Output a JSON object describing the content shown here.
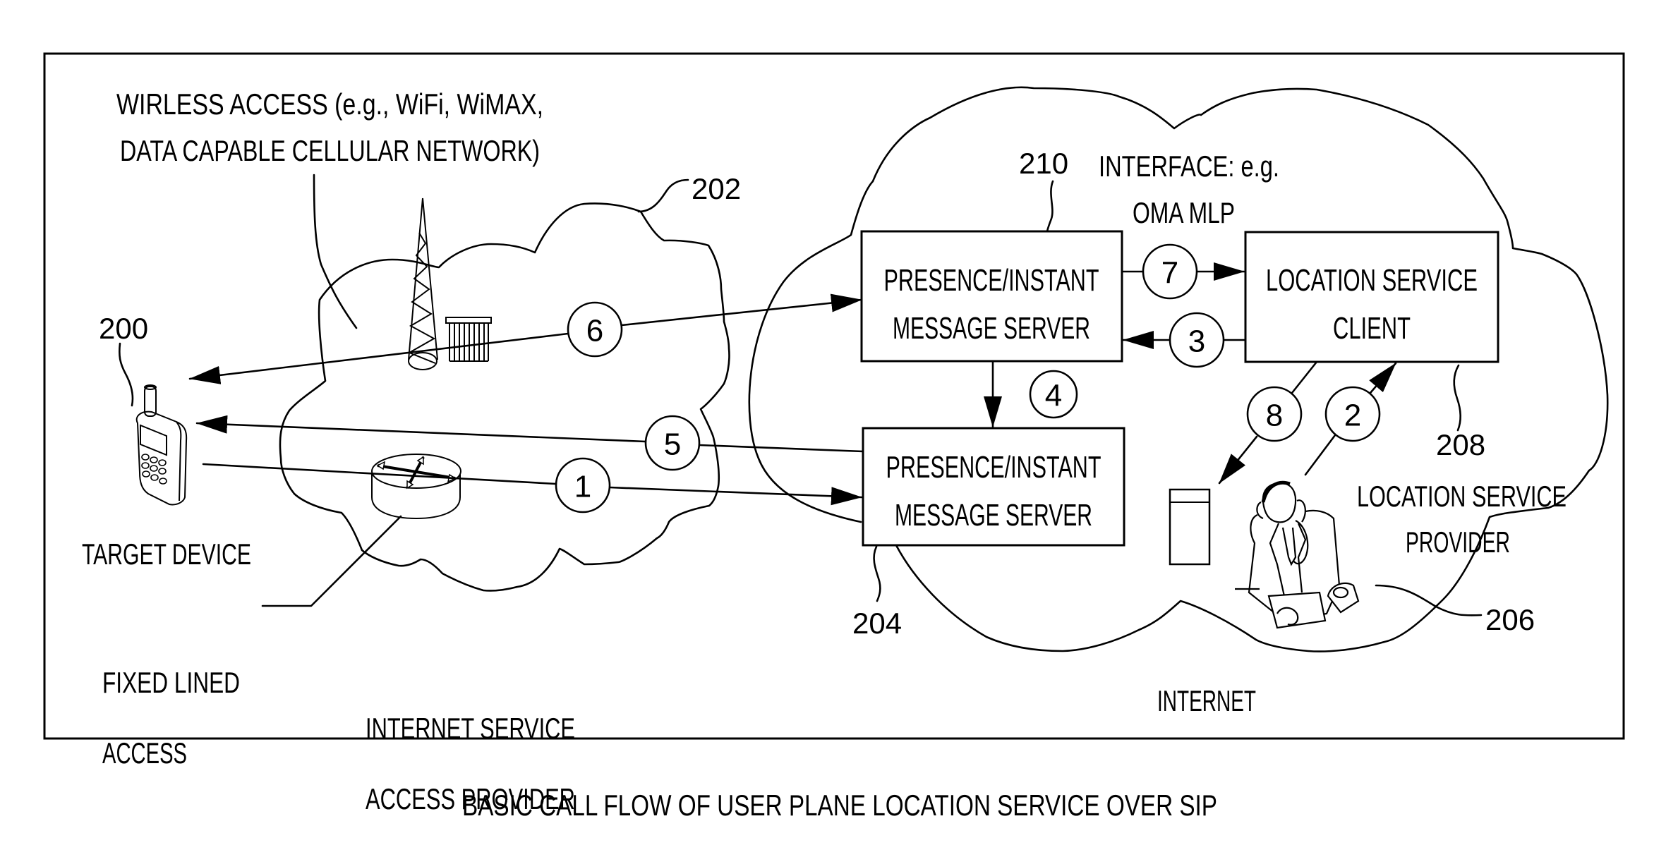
{
  "figure": {
    "caption": "BASIC CALL FLOW OF USER PLANE LOCATION SERVICE OVER SIP",
    "labels": {
      "wireless_access_line1": "WIRLESS ACCESS (e.g., WiFi, WiMAX,",
      "wireless_access_line2": "DATA CAPABLE CELLULAR NETWORK)",
      "target_device": "TARGET DEVICE",
      "fixed_lined_line1": "FIXED LINED",
      "fixed_lined_line2": "ACCESS",
      "isp_line1": "INTERNET SERVICE",
      "isp_line2": "ACCESS PROVIDER",
      "interface_line1": "INTERFACE: e.g.",
      "interface_line2": "OMA MLP",
      "internet": "INTERNET",
      "lsp_line1": "LOCATION SERVICE",
      "lsp_line2": "PROVIDER"
    },
    "reference_numerals": {
      "target_device": "200",
      "isp_cloud": "202",
      "presence_server_bottom": "204",
      "location_service_provider": "206",
      "location_service_client": "208",
      "interface": "210"
    },
    "boxes": {
      "presence_server_top": {
        "line1": "PRESENCE/INSTANT",
        "line2": "MESSAGE SERVER"
      },
      "presence_server_bottom": {
        "line1": "PRESENCE/INSTANT",
        "line2": "MESSAGE SERVER"
      },
      "location_client": {
        "line1": "LOCATION SERVICE",
        "line2": "CLIENT"
      }
    },
    "steps": [
      "1",
      "2",
      "3",
      "4",
      "5",
      "6",
      "7",
      "8"
    ],
    "flows": [
      {
        "step": "1",
        "from": "target device",
        "to": "presence server (bottom)"
      },
      {
        "step": "2",
        "from": "location service provider",
        "to": "location service client"
      },
      {
        "step": "3",
        "from": "location service client",
        "to": "presence server (top)"
      },
      {
        "step": "4",
        "from": "presence server (top)",
        "to": "presence server (bottom)"
      },
      {
        "step": "5",
        "from": "presence server (bottom)",
        "to": "target device"
      },
      {
        "step": "6",
        "from": "presence server (top)",
        "to": "target device",
        "bidirectional": true
      },
      {
        "step": "7",
        "from": "presence server (top)",
        "to": "location service client"
      },
      {
        "step": "8",
        "from": "location service client",
        "to": "location service provider"
      }
    ]
  }
}
